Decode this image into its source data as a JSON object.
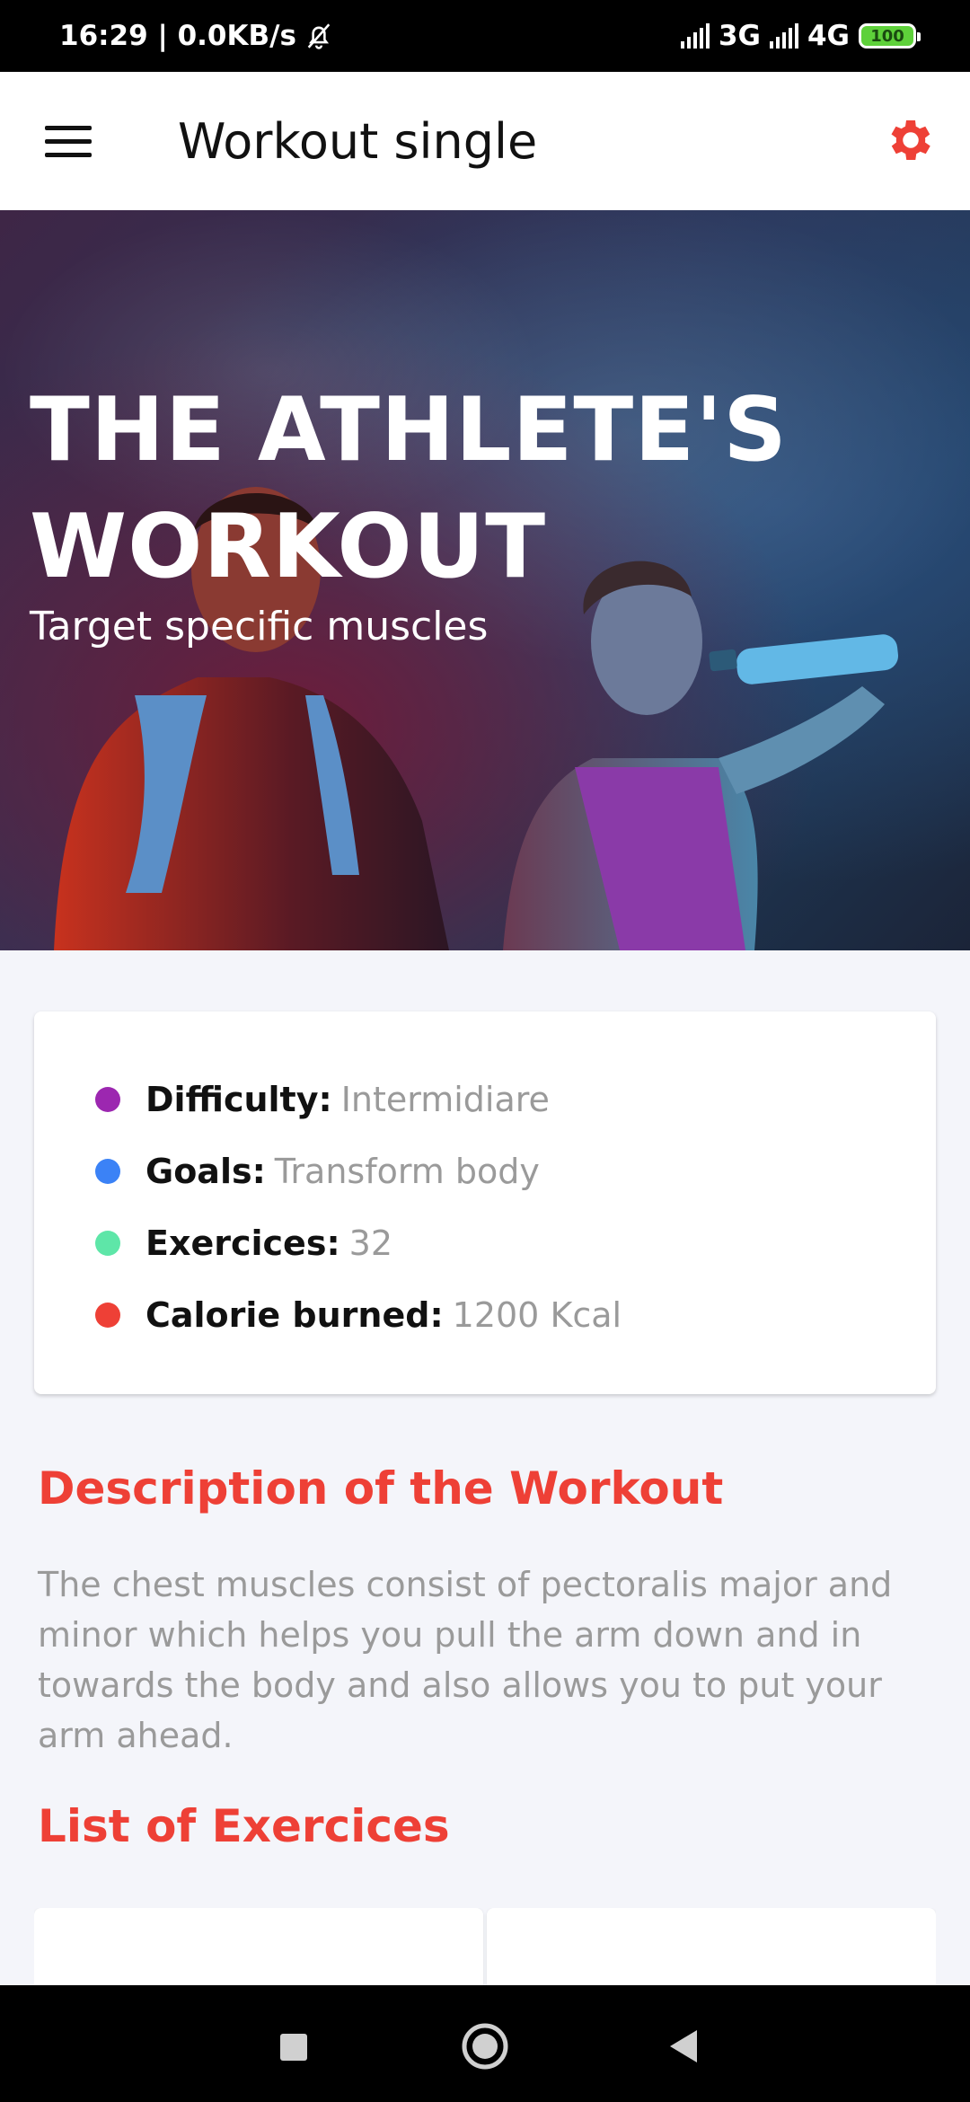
{
  "status_bar": {
    "time_speed": "16:29 | 0.0KB/s",
    "network_1": "3G",
    "network_2": "4G",
    "battery": "100"
  },
  "app_bar": {
    "title": "Workout single"
  },
  "hero": {
    "title": "THE ATHLETE'S WORKOUT",
    "subtitle": "Target specific muscles"
  },
  "info": {
    "items": [
      {
        "label": "Difficulty:",
        "value": "Intermidiare",
        "color": "#9c27b0"
      },
      {
        "label": "Goals:",
        "value": "Transform body",
        "color": "#3b82f6"
      },
      {
        "label": "Exercices:",
        "value": "32",
        "color": "#5ee6a8"
      },
      {
        "label": "Calorie burned:",
        "value": "1200 Kcal",
        "color": "#ee4036"
      }
    ]
  },
  "description": {
    "heading": "Description of the Workout",
    "text": "The chest muscles consist of pectoralis major and minor which helps you pull the arm down and in towards the body and also allows you to put your arm ahead."
  },
  "exercises": {
    "heading": "List of Exercices"
  },
  "colors": {
    "accent": "#ee4036"
  }
}
